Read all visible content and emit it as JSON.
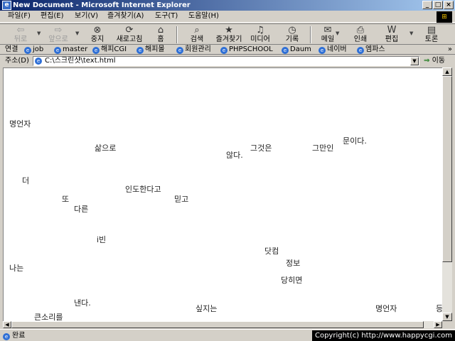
{
  "window": {
    "title": "New Document - Microsoft Internet Explorer",
    "buttons": {
      "minimize": "_",
      "maximize": "□",
      "close": "×"
    }
  },
  "menu": [
    "파일(F)",
    "편집(E)",
    "보기(V)",
    "즐겨찾기(A)",
    "도구(T)",
    "도움말(H)"
  ],
  "toolbar": {
    "back": "뒤로",
    "forward": "앞으로",
    "stop": "중지",
    "refresh": "새로고침",
    "home": "홈",
    "search": "검색",
    "favorites": "즐겨찾기",
    "media": "미디어",
    "history": "기록",
    "mail": "메일",
    "print": "인쇄",
    "edit": "편집",
    "discuss": "토론"
  },
  "links": {
    "label": "연결",
    "items": [
      "job",
      "master",
      "해피CGI",
      "해피몰",
      "회원관리",
      "PHPSCHOOL",
      "Daum",
      "네이버",
      "엠파스"
    ],
    "more": "»"
  },
  "address": {
    "label": "주소(D)",
    "value": "C:\\스크린샷\\text.html",
    "go": "이동"
  },
  "page": {
    "words": [
      "명언자",
      "삶으로",
      "그것은",
      "그만인",
      "문이다.",
      "않다.",
      "더",
      "인도한다고",
      "믿고",
      "또",
      "다른",
      "i빈",
      "닷컴",
      "정보",
      "나는",
      "당히면",
      "낸다.",
      "싶지는",
      "명언자",
      "큰소리를",
      "등"
    ]
  },
  "status": {
    "text": "완료",
    "copyright": "Copyright(c) http://www.happycgi.com"
  }
}
